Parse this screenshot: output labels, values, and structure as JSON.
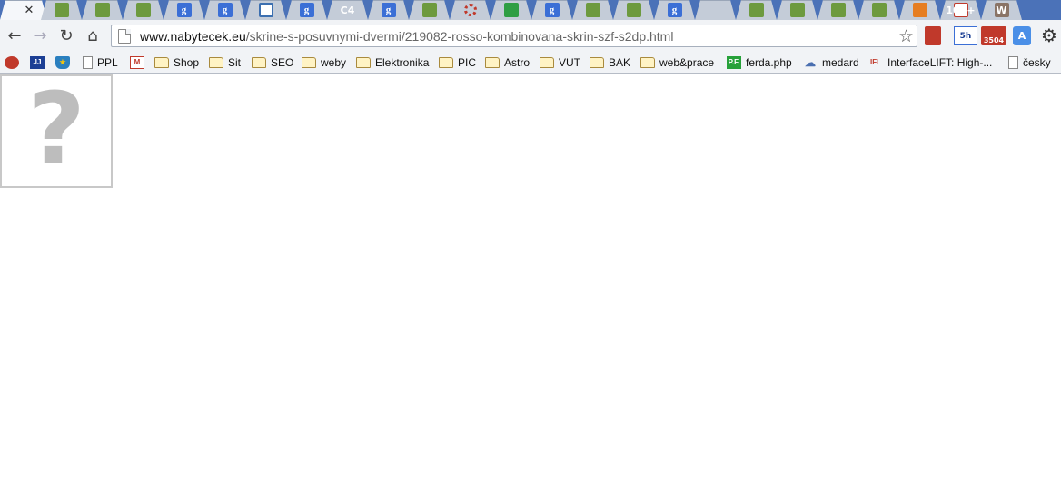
{
  "browser": {
    "url_host": "www.nabytecek.eu",
    "url_path": "/skrine-s-posuvnymi-dvermi/219082-rosso-kombinovana-skrin-szf-s2dp.html",
    "active_tab_close": "✕",
    "tabs": [
      {
        "icon": "leaf",
        "text": ""
      },
      {
        "icon": "leaf",
        "text": ""
      },
      {
        "icon": "leaf",
        "text": ""
      },
      {
        "icon": "leaf",
        "text": ""
      },
      {
        "icon": "google",
        "text": "g"
      },
      {
        "icon": "google",
        "text": "g"
      },
      {
        "icon": "ring",
        "text": ""
      },
      {
        "icon": "google",
        "text": "g"
      },
      {
        "icon": "c4",
        "text": "C4"
      },
      {
        "icon": "google",
        "text": "g"
      },
      {
        "icon": "leaf",
        "text": ""
      },
      {
        "icon": "dots",
        "text": ""
      },
      {
        "icon": "green-door",
        "text": ""
      },
      {
        "icon": "google",
        "text": "g"
      },
      {
        "icon": "leaf",
        "text": ""
      },
      {
        "icon": "leaf",
        "text": ""
      },
      {
        "icon": "google",
        "text": "g"
      },
      {
        "icon": "blank",
        "text": ""
      },
      {
        "icon": "leaf",
        "text": ""
      },
      {
        "icon": "leaf",
        "text": ""
      },
      {
        "icon": "leaf",
        "text": ""
      },
      {
        "icon": "leaf",
        "text": ""
      },
      {
        "icon": "chart",
        "text": ""
      },
      {
        "icon": "gmail",
        "text": "100+"
      },
      {
        "icon": "w",
        "text": "W"
      }
    ],
    "extensions": {
      "calendar": "5h",
      "gmail_count": "3504",
      "translate": "A"
    }
  },
  "bookmarks": [
    {
      "icon": "ladybug",
      "label": ""
    },
    {
      "icon": "jj",
      "label": ""
    },
    {
      "icon": "shield",
      "label": ""
    },
    {
      "icon": "page",
      "label": "PPL"
    },
    {
      "icon": "gmail",
      "label": ""
    },
    {
      "icon": "folder",
      "label": "Shop"
    },
    {
      "icon": "folder",
      "label": "Sit"
    },
    {
      "icon": "folder",
      "label": "SEO"
    },
    {
      "icon": "folder",
      "label": "weby"
    },
    {
      "icon": "folder",
      "label": "Elektronika"
    },
    {
      "icon": "folder",
      "label": "PIC"
    },
    {
      "icon": "folder",
      "label": "Astro"
    },
    {
      "icon": "folder",
      "label": "VUT"
    },
    {
      "icon": "folder",
      "label": "BAK"
    },
    {
      "icon": "folder",
      "label": "web&prace"
    },
    {
      "icon": "pf",
      "label": "ferda.php"
    },
    {
      "icon": "cloud",
      "label": "medard"
    },
    {
      "icon": "ifl",
      "label": "InterfaceLIFT: High-..."
    },
    {
      "icon": "page",
      "label": "česky"
    }
  ],
  "content": {
    "broken_image_glyph": "?"
  }
}
